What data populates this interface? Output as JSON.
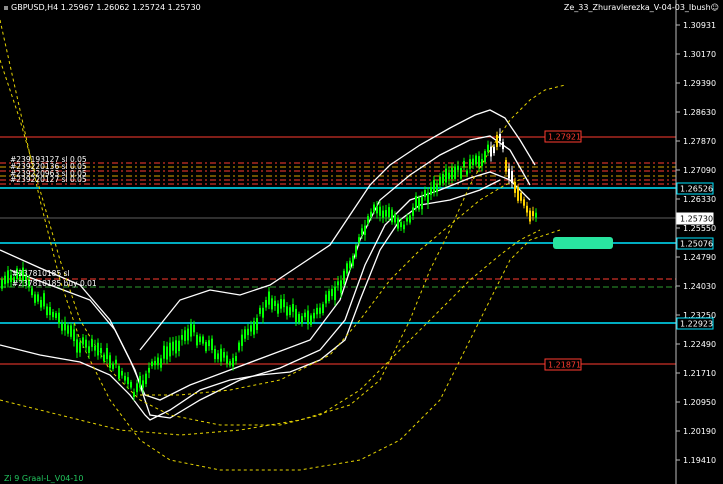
{
  "header": {
    "symbol_info": "GBPUSD,H4  1.25967 1.26062 1.25724 1.25730",
    "indicator_title": "Ze_33_Zhuravlerezka_V-04-03_Ibush☺"
  },
  "footer": {
    "label": "Zi 9 Graal-L_V04-10"
  },
  "axis": {
    "ticks": [
      "1.30931",
      "1.30170",
      "1.29390",
      "1.28630",
      "1.27870",
      "1.27090",
      "1.26330",
      "1.25550",
      "1.24790",
      "1.24030",
      "1.23250",
      "1.22490",
      "1.21710",
      "1.20950",
      "1.20190",
      "1.19410"
    ]
  },
  "level_labels": [
    {
      "text": "1.27921",
      "color": "#ff3b2f",
      "style": "outline"
    },
    {
      "text": "1.26526",
      "color": "#00e5ff",
      "style": "filled"
    },
    {
      "text": "1.25730",
      "color": "#ffffff",
      "style": "filled-white"
    },
    {
      "text": "1.25076",
      "color": "#00e5ff",
      "style": "filled"
    },
    {
      "text": "1.22923",
      "color": "#00e5ff",
      "style": "filled"
    },
    {
      "text": "1.21871",
      "color": "#ff3b2f",
      "style": "outline"
    }
  ],
  "order_labels": {
    "upper": [
      "#239193127 sl 0.05",
      "#239220136 sl 0.05",
      "#239220963 sl 0.05",
      "#239220127 sl 0.05"
    ],
    "lower": [
      "#237810185 sl",
      "#237810185 buy 0.01"
    ]
  },
  "colors": {
    "background": "#000000",
    "candle": "#00ff00",
    "band": "#ffffff",
    "ma": "#e6d400",
    "support_resistance": "#00e5ff",
    "level_red": "#ff3b2f",
    "order_green": "#2e9d2e",
    "signal": "#29e5a0"
  }
}
